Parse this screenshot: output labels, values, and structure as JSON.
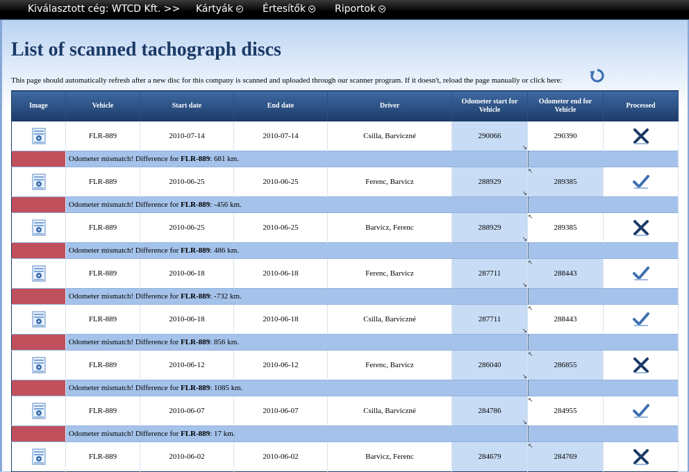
{
  "nav": {
    "company": "Kiválasztott cég: WTCD Kft. >>",
    "cards": "Kártyák",
    "notifications": "Értesítők",
    "reports": "Riportok"
  },
  "page": {
    "title": "List of scanned tachograph discs",
    "info": "This page should automatically refresh after a new disc for this company is scanned and uploaded through our scanner program. If it doesn't, reload the page manually or click here:"
  },
  "table": {
    "headers": {
      "image": "Image",
      "vehicle": "Vehicle",
      "start": "Start date",
      "end": "End date",
      "driver": "Driver",
      "odo_start": "Odometer start for Vehicle",
      "odo_end": "Odometer end for Vehicle",
      "processed": "Processed"
    },
    "rows": [
      {
        "vehicle": "FLR-889",
        "start": "2010-07-14",
        "end": "2010-07-14",
        "driver": "Csilla, Barviczné",
        "odo_start": "290066",
        "odo_end": "290390",
        "processed": false
      },
      {
        "vehicle": "FLR-889",
        "start": "2010-06-25",
        "end": "2010-06-25",
        "driver": "Ferenc, Barvicz",
        "odo_start": "288929",
        "odo_end": "289385",
        "processed": true
      },
      {
        "vehicle": "FLR-889",
        "start": "2010-06-25",
        "end": "2010-06-25",
        "driver": "Barvicz, Ferenc",
        "odo_start": "288929",
        "odo_end": "289385",
        "processed": false
      },
      {
        "vehicle": "FLR-889",
        "start": "2010-06-18",
        "end": "2010-06-18",
        "driver": "Ferenc, Barvicz",
        "odo_start": "287711",
        "odo_end": "288443",
        "processed": true
      },
      {
        "vehicle": "FLR-889",
        "start": "2010-06-18",
        "end": "2010-06-18",
        "driver": "Csilla, Barviczné",
        "odo_start": "287711",
        "odo_end": "288443",
        "processed": true
      },
      {
        "vehicle": "FLR-889",
        "start": "2010-06-12",
        "end": "2010-06-12",
        "driver": "Ferenc, Barvicz",
        "odo_start": "286040",
        "odo_end": "286855",
        "processed": false
      },
      {
        "vehicle": "FLR-889",
        "start": "2010-06-07",
        "end": "2010-06-07",
        "driver": "Csilla, Barviczné",
        "odo_start": "284786",
        "odo_end": "284955",
        "processed": true
      },
      {
        "vehicle": "FLR-889",
        "start": "2010-06-02",
        "end": "2010-06-02",
        "driver": "Barvicz, Ferenc",
        "odo_start": "284679",
        "odo_end": "284769",
        "processed": false
      }
    ],
    "warnings": [
      {
        "prefix": "Odometer mismatch! Difference for ",
        "vehicle": "FLR-889",
        "suffix": ": 681 km."
      },
      {
        "prefix": "Odometer mismatch! Difference for ",
        "vehicle": "FLR-889",
        "suffix": ": -456 km."
      },
      {
        "prefix": "Odometer mismatch! Difference for ",
        "vehicle": "FLR-889",
        "suffix": ": 486 km."
      },
      {
        "prefix": "Odometer mismatch! Difference for ",
        "vehicle": "FLR-889",
        "suffix": ": -732 km."
      },
      {
        "prefix": "Odometer mismatch! Difference for ",
        "vehicle": "FLR-889",
        "suffix": ": 856 km."
      },
      {
        "prefix": "Odometer mismatch! Difference for ",
        "vehicle": "FLR-889",
        "suffix": ": 1085 km."
      },
      {
        "prefix": "Odometer mismatch! Difference for ",
        "vehicle": "FLR-889",
        "suffix": ": 17 km."
      }
    ]
  },
  "colors": {
    "header_bg": "#1b3a66",
    "warning_flag": "#c0505c",
    "warning_row": "#a5c3ea",
    "odometer_cell": "#c8dcf5"
  },
  "icons": {
    "image": "disc-image-icon",
    "processed_yes": "checkmark-icon",
    "processed_no": "cross-icon",
    "refresh": "refresh-icon",
    "dropdown": "circle-chevron-down-icon"
  }
}
